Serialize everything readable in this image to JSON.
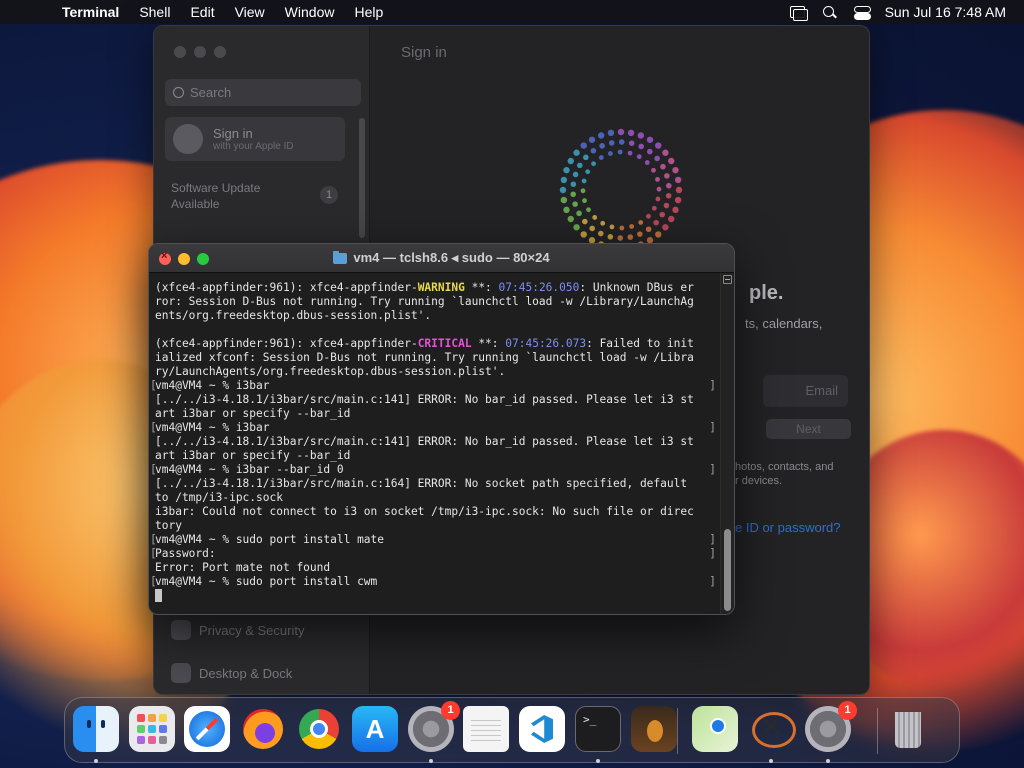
{
  "menubar": {
    "app_name": "Terminal",
    "menus": [
      "Shell",
      "Edit",
      "View",
      "Window",
      "Help"
    ],
    "clock": "Sun Jul 16  7:48 AM"
  },
  "settings_window": {
    "search_placeholder": "Search",
    "signin_title": "Sign in",
    "signin_subtitle": "with your Apple ID",
    "update_line1": "Software Update",
    "update_line2": "Available",
    "update_badge": "1",
    "sidebar_items": [
      "Privacy & Security",
      "Desktop & Dock"
    ],
    "main_title": "Sign in",
    "headline": "ple.",
    "subtext": "ts, calendars,",
    "email_placeholder": "Email",
    "next_label": "Next",
    "info_line1": "hotos, contacts, and",
    "info_line2": "r devices.",
    "forgot_link": "e ID or password?"
  },
  "terminal": {
    "title": "vm4 — tclsh8.6 ◂ sudo — 80×24",
    "lines": [
      {
        "parts": [
          {
            "t": "(xfce4-appfinder:961): xfce4-appfinder-"
          },
          {
            "t": "WARNING",
            "c": "warn"
          },
          {
            "t": " **: "
          },
          {
            "t": "07:45:26.050",
            "c": "ts"
          },
          {
            "t": ": Unknown DBus er"
          }
        ]
      },
      {
        "parts": [
          {
            "t": "ror: Session D-Bus not running. Try running `launchctl load -w /Library/LaunchAg"
          }
        ]
      },
      {
        "parts": [
          {
            "t": "ents/org.freedesktop.dbus-session.plist'."
          }
        ]
      },
      {
        "parts": [
          {
            "t": ""
          }
        ]
      },
      {
        "parts": [
          {
            "t": "(xfce4-appfinder:961): xfce4-appfinder-"
          },
          {
            "t": "CRITICAL",
            "c": "crit"
          },
          {
            "t": " **: "
          },
          {
            "t": "07:45:26.073",
            "c": "ts"
          },
          {
            "t": ": Failed to init"
          }
        ]
      },
      {
        "parts": [
          {
            "t": "ialized xfconf: Session D-Bus not running. Try running `launchctl load -w /Libra"
          }
        ]
      },
      {
        "parts": [
          {
            "t": "ry/LaunchAgents/org.freedesktop.dbus-session.plist'."
          }
        ]
      },
      {
        "mark": true,
        "parts": [
          {
            "t": "vm4@VM4 ~ % i3bar"
          }
        ]
      },
      {
        "parts": [
          {
            "t": "[../../i3-4.18.1/i3bar/src/main.c:141] ERROR: No bar_id passed. Please let i3 st"
          }
        ]
      },
      {
        "parts": [
          {
            "t": "art i3bar or specify --bar_id"
          }
        ]
      },
      {
        "mark": true,
        "parts": [
          {
            "t": "vm4@VM4 ~ % i3bar"
          }
        ]
      },
      {
        "parts": [
          {
            "t": "[../../i3-4.18.1/i3bar/src/main.c:141] ERROR: No bar_id passed. Please let i3 st"
          }
        ]
      },
      {
        "parts": [
          {
            "t": "art i3bar or specify --bar_id"
          }
        ]
      },
      {
        "mark": true,
        "parts": [
          {
            "t": "vm4@VM4 ~ % i3bar --bar_id 0"
          }
        ]
      },
      {
        "parts": [
          {
            "t": "[../../i3-4.18.1/i3bar/src/main.c:164] ERROR: No socket path specified, default"
          }
        ]
      },
      {
        "parts": [
          {
            "t": "to /tmp/i3-ipc.sock"
          }
        ]
      },
      {
        "parts": [
          {
            "t": "i3bar: Could not connect to i3 on socket /tmp/i3-ipc.sock: No such file or direc"
          }
        ]
      },
      {
        "parts": [
          {
            "t": "tory"
          }
        ]
      },
      {
        "mark": true,
        "parts": [
          {
            "t": "vm4@VM4 ~ % sudo port install mate"
          }
        ]
      },
      {
        "mark": true,
        "parts": [
          {
            "t": "Password:"
          }
        ]
      },
      {
        "parts": [
          {
            "t": "Error: Port mate not found"
          }
        ]
      },
      {
        "mark": true,
        "parts": [
          {
            "t": "vm4@VM4 ~ % sudo port install cwm"
          }
        ]
      }
    ]
  },
  "dock": {
    "apps": [
      {
        "name": "finder-icon",
        "label": "Finder",
        "running": true
      },
      {
        "name": "launchpad-icon",
        "label": "Launchpad",
        "running": false
      },
      {
        "name": "safari-icon",
        "label": "Safari",
        "running": false
      },
      {
        "name": "firefox-icon",
        "label": "Firefox",
        "running": false
      },
      {
        "name": "chrome-icon",
        "label": "Google Chrome",
        "running": false
      },
      {
        "name": "app-store-icon",
        "label": "App Store",
        "running": false
      },
      {
        "name": "system-settings-icon",
        "label": "System Settings",
        "running": true,
        "badge": "1"
      },
      {
        "name": "textedit-icon",
        "label": "TextEdit",
        "running": false
      },
      {
        "name": "vscode-icon",
        "label": "Visual Studio Code",
        "running": false
      },
      {
        "name": "terminal-icon",
        "label": "Terminal",
        "running": true
      },
      {
        "name": "garageband-icon",
        "label": "GarageBand",
        "running": false
      },
      {
        "name": "maps-icon",
        "label": "Maps",
        "running": false
      },
      {
        "name": "xquartz-icon",
        "label": "XQuartz",
        "running": true
      },
      {
        "name": "software-update-icon",
        "label": "Software Update",
        "running": true,
        "badge": "1"
      },
      {
        "name": "trash-icon",
        "label": "Trash",
        "running": false
      }
    ]
  },
  "colors": {
    "warning": "#e8d84c",
    "critical": "#e054d8",
    "timestamp": "#7d8ef0",
    "badge": "#ff3b30"
  }
}
